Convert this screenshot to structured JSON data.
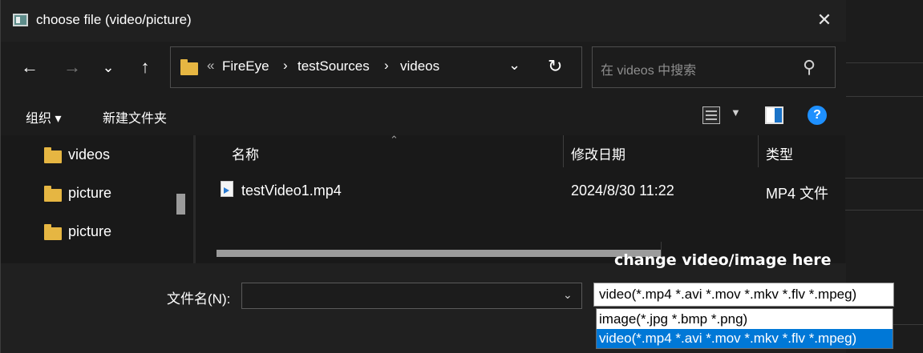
{
  "window": {
    "title": "choose file (video/picture)"
  },
  "nav": {
    "back_icon": "arrow-left",
    "forward_icon": "arrow-right",
    "recent_icon": "chevron-down",
    "up_icon": "arrow-up",
    "breadcrumb_overflow": "«",
    "breadcrumb": [
      "FireEye",
      "testSources",
      "videos"
    ],
    "breadcrumb_separator": "›",
    "search_placeholder": "在 videos 中搜索"
  },
  "toolbar": {
    "organize_label": "组织 ▾",
    "new_folder_label": "新建文件夹"
  },
  "sidebar": {
    "items": [
      {
        "label": "videos"
      },
      {
        "label": "picture"
      },
      {
        "label": "picture"
      }
    ]
  },
  "file_list": {
    "columns": [
      "名称",
      "修改日期",
      "类型"
    ],
    "rows": [
      {
        "name": "testVideo1.mp4",
        "modified": "2024/8/30 11:22",
        "type": "MP4 文件"
      }
    ]
  },
  "bottom": {
    "filename_label": "文件名(N):",
    "filename_value": "",
    "annotation": "change video/image here",
    "filetype_selected": "video(*.mp4 *.avi *.mov *.mkv *.flv *.mpeg)",
    "filetype_options": [
      "image(*.jpg *.bmp *.png)",
      "video(*.mp4 *.avi *.mov *.mkv *.flv *.mpeg)"
    ]
  },
  "colors": {
    "accent": "#0078d7",
    "folder": "#e6b642",
    "help": "#1e90ff",
    "dialog_bg": "#202020"
  }
}
